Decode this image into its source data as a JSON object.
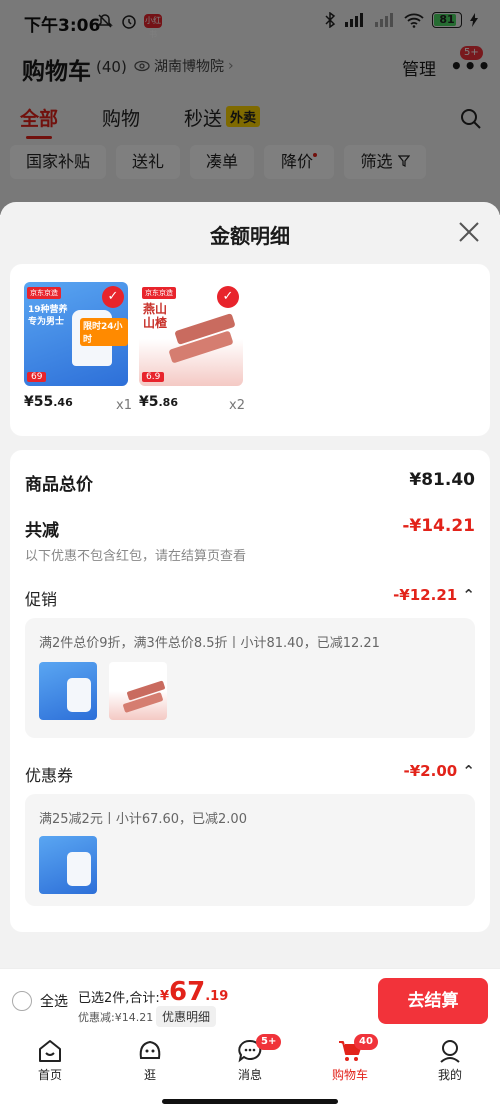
{
  "status_bar": {
    "time": "下午3:06",
    "battery": "81",
    "app_badge": "小红书"
  },
  "header": {
    "title": "购物车",
    "count": "(40)",
    "location": "湖南博物院",
    "manage": "管理",
    "more_badge": "5+"
  },
  "tabs": [
    {
      "label": "全部"
    },
    {
      "label": "购物"
    },
    {
      "label": "秒送",
      "tag": "外卖"
    }
  ],
  "filters": [
    {
      "label": "国家补贴"
    },
    {
      "label": "送礼"
    },
    {
      "label": "凑单"
    },
    {
      "label": "降价"
    },
    {
      "label": "筛选"
    }
  ],
  "sheet": {
    "title": "金额明细",
    "products": [
      {
        "name": "19种营养专为男士",
        "price_int": "¥55",
        "price_dec": ".46",
        "qty": "x1",
        "brand": "京东京造",
        "promo": "限时24小时",
        "img_price": "69"
      },
      {
        "name": "燕山山楂",
        "price_int": "¥5",
        "price_dec": ".86",
        "qty": "x2",
        "brand": "京东京造",
        "img_price": "6.9"
      }
    ],
    "summary": {
      "total_label": "商品总价",
      "total_value": "¥81.40",
      "discount_label": "共减",
      "discount_value": "-¥14.21",
      "note": "以下优惠不包含红包，请在结算页查看"
    },
    "promotion": {
      "label": "促销",
      "value": "-¥12.21",
      "detail": "满2件总价9折，满3件总价8.5折丨小计81.40，已减12.21"
    },
    "coupon": {
      "label": "优惠券",
      "value": "-¥2.00",
      "detail": "满25减2元丨小计67.60，已减2.00"
    }
  },
  "bottom_bar": {
    "select_all": "全选",
    "selected": "已选2件,合计:",
    "currency": "¥",
    "total_int": "67",
    "total_dec": ".19",
    "discount": "优惠减:¥14.21",
    "detail_button": "优惠明细",
    "checkout": "去结算"
  },
  "nav": [
    {
      "label": "首页"
    },
    {
      "label": "逛"
    },
    {
      "label": "消息",
      "badge": "5+"
    },
    {
      "label": "购物车",
      "badge": "40"
    },
    {
      "label": "我的"
    }
  ],
  "colors": {
    "accent": "#e2231a",
    "button": "#f2333a",
    "waimai": "#ffd400"
  }
}
